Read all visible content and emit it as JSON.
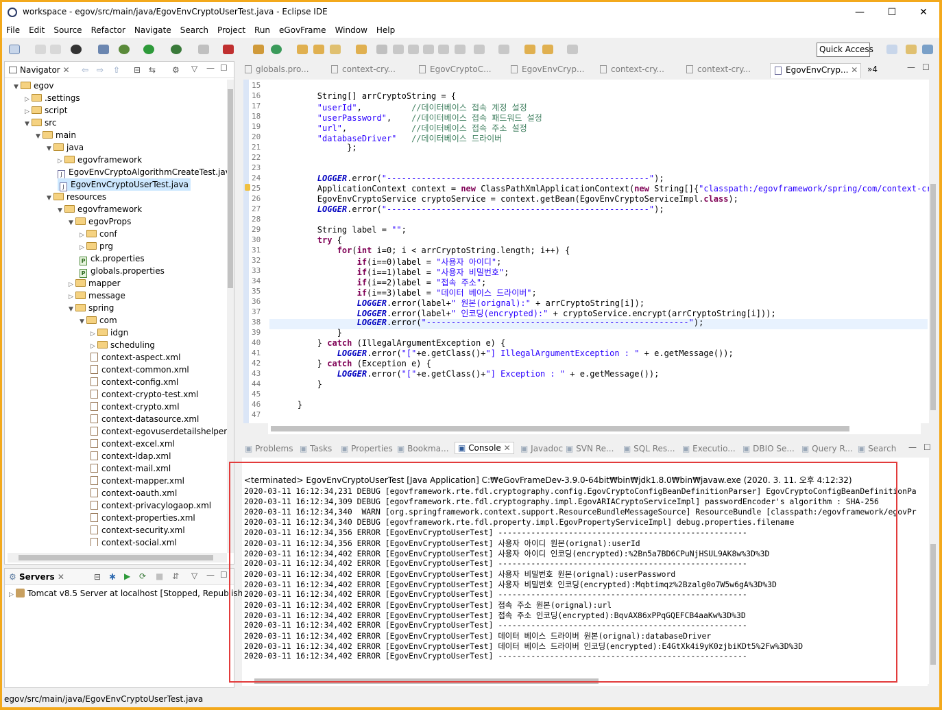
{
  "window": {
    "title": "workspace - egov/src/main/java/EgovEnvCryptoUserTest.java - Eclipse IDE",
    "minimize": "—",
    "maximize": "☐",
    "close": "✕"
  },
  "menu": [
    "File",
    "Edit",
    "Source",
    "Refactor",
    "Navigate",
    "Search",
    "Project",
    "Run",
    "eGovFrame",
    "Window",
    "Help"
  ],
  "toolbar": {
    "quick_access": "Quick Access"
  },
  "navigator": {
    "title": "Navigator",
    "items": [
      {
        "label": "egov",
        "kind": "project",
        "depth": 0,
        "open": true
      },
      {
        "label": ".settings",
        "kind": "folder",
        "depth": 1,
        "open": false
      },
      {
        "label": "script",
        "kind": "folder",
        "depth": 1,
        "open": false
      },
      {
        "label": "src",
        "kind": "folder",
        "depth": 1,
        "open": true
      },
      {
        "label": "main",
        "kind": "folder",
        "depth": 2,
        "open": true
      },
      {
        "label": "java",
        "kind": "folder",
        "depth": 3,
        "open": true
      },
      {
        "label": "egovframework",
        "kind": "folder",
        "depth": 4,
        "open": false
      },
      {
        "label": "EgovEnvCryptoAlgorithmCreateTest.java",
        "kind": "java",
        "depth": 4
      },
      {
        "label": "EgovEnvCryptoUserTest.java",
        "kind": "java",
        "depth": 4,
        "selected": true
      },
      {
        "label": "resources",
        "kind": "folder",
        "depth": 3,
        "open": true
      },
      {
        "label": "egovframework",
        "kind": "folder",
        "depth": 4,
        "open": true
      },
      {
        "label": "egovProps",
        "kind": "folder",
        "depth": 5,
        "open": true
      },
      {
        "label": "conf",
        "kind": "folder",
        "depth": 6,
        "open": false
      },
      {
        "label": "prg",
        "kind": "folder",
        "depth": 6,
        "open": false
      },
      {
        "label": "ck.properties",
        "kind": "props",
        "depth": 6
      },
      {
        "label": "globals.properties",
        "kind": "props",
        "depth": 6
      },
      {
        "label": "mapper",
        "kind": "folder",
        "depth": 5,
        "open": false
      },
      {
        "label": "message",
        "kind": "folder",
        "depth": 5,
        "open": false
      },
      {
        "label": "spring",
        "kind": "folder",
        "depth": 5,
        "open": true
      },
      {
        "label": "com",
        "kind": "folder",
        "depth": 6,
        "open": true
      },
      {
        "label": "idgn",
        "kind": "folder",
        "depth": 7,
        "open": false
      },
      {
        "label": "scheduling",
        "kind": "folder",
        "depth": 7,
        "open": false
      },
      {
        "label": "context-aspect.xml",
        "kind": "xml",
        "depth": 7
      },
      {
        "label": "context-common.xml",
        "kind": "xml",
        "depth": 7
      },
      {
        "label": "context-config.xml",
        "kind": "xml",
        "depth": 7
      },
      {
        "label": "context-crypto-test.xml",
        "kind": "xml",
        "depth": 7
      },
      {
        "label": "context-crypto.xml",
        "kind": "xml",
        "depth": 7
      },
      {
        "label": "context-datasource.xml",
        "kind": "xml",
        "depth": 7
      },
      {
        "label": "context-egovuserdetailshelper.x",
        "kind": "xml",
        "depth": 7
      },
      {
        "label": "context-excel.xml",
        "kind": "xml",
        "depth": 7
      },
      {
        "label": "context-ldap.xml",
        "kind": "xml",
        "depth": 7
      },
      {
        "label": "context-mail.xml",
        "kind": "xml",
        "depth": 7
      },
      {
        "label": "context-mapper.xml",
        "kind": "xml",
        "depth": 7
      },
      {
        "label": "context-oauth.xml",
        "kind": "xml",
        "depth": 7
      },
      {
        "label": "context-privacylogaop.xml",
        "kind": "xml",
        "depth": 7
      },
      {
        "label": "context-properties.xml",
        "kind": "xml",
        "depth": 7
      },
      {
        "label": "context-security.xml",
        "kind": "xml",
        "depth": 7
      },
      {
        "label": "context-social.xml",
        "kind": "xml",
        "depth": 7
      }
    ]
  },
  "servers": {
    "title": "Servers",
    "item": "Tomcat v8.5 Server at localhost  [Stopped, Republish]"
  },
  "editor": {
    "tabs": [
      "globals.pro...",
      "context-cry...",
      "EgovCryptoC...",
      "EgovEnvCryp...",
      "context-cry...",
      "context-cry...",
      "EgovEnvCryp..."
    ],
    "overflow": "»4",
    "lines": [
      {
        "n": "15",
        "t": ""
      },
      {
        "n": "16",
        "t": "        String[] arrCryptoString = {"
      },
      {
        "n": "17",
        "t": "        \"userId\",          //데이터베이스 접속 계정 설정"
      },
      {
        "n": "18",
        "t": "        \"userPassword\",    //데이터베이스 접속 패드워드 설정"
      },
      {
        "n": "19",
        "t": "        \"url\",             //데이터베이스 접속 주소 설정"
      },
      {
        "n": "20",
        "t": "        \"databaseDriver\"   //데이터베이스 드라이버"
      },
      {
        "n": "21",
        "t": "              };"
      },
      {
        "n": "22",
        "t": ""
      },
      {
        "n": "23",
        "t": ""
      },
      {
        "n": "24",
        "t": "        LOGGER.error(\"-----------------------------------------------------\");"
      },
      {
        "n": "25",
        "t": "        ApplicationContext context = new ClassPathXmlApplicationContext(new String[]{\"classpath:/egovframework/spring/com/context-crypto"
      },
      {
        "n": "26",
        "t": "        EgovEnvCryptoService cryptoService = context.getBean(EgovEnvCryptoServiceImpl.class);"
      },
      {
        "n": "27",
        "t": "        LOGGER.error(\"-----------------------------------------------------\");"
      },
      {
        "n": "28",
        "t": ""
      },
      {
        "n": "29",
        "t": "        String label = \"\";"
      },
      {
        "n": "30",
        "t": "        try {"
      },
      {
        "n": "31",
        "t": "            for(int i=0; i < arrCryptoString.length; i++) {"
      },
      {
        "n": "32",
        "t": "                if(i==0)label = \"사용자 아이디\";"
      },
      {
        "n": "33",
        "t": "                if(i==1)label = \"사용자 비밀번호\";"
      },
      {
        "n": "34",
        "t": "                if(i==2)label = \"접속 주소\";"
      },
      {
        "n": "35",
        "t": "                if(i==3)label = \"데이터 베이스 드라이버\";"
      },
      {
        "n": "36",
        "t": "                LOGGER.error(label+\" 원본(orignal):\" + arrCryptoString[i]);"
      },
      {
        "n": "37",
        "t": "                LOGGER.error(label+\" 인코딩(encrypted):\" + cryptoService.encrypt(arrCryptoString[i]));"
      },
      {
        "n": "38",
        "t": "                LOGGER.error(\"-----------------------------------------------------\");"
      },
      {
        "n": "39",
        "t": "            }"
      },
      {
        "n": "40",
        "t": "        } catch (IllegalArgumentException e) {"
      },
      {
        "n": "41",
        "t": "            LOGGER.error(\"[\"+e.getClass()+\"] IllegalArgumentException : \" + e.getMessage());"
      },
      {
        "n": "42",
        "t": "        } catch (Exception e) {"
      },
      {
        "n": "43",
        "t": "            LOGGER.error(\"[\"+e.getClass()+\"] Exception : \" + e.getMessage());"
      },
      {
        "n": "44",
        "t": "        }"
      },
      {
        "n": "45",
        "t": ""
      },
      {
        "n": "46",
        "t": "    }"
      },
      {
        "n": "47",
        "t": ""
      }
    ]
  },
  "bottom_tabs": [
    "Problems",
    "Tasks",
    "Properties",
    "Bookma...",
    "Console",
    "Javadoc",
    "SVN Re...",
    "SQL Res...",
    "Executio...",
    "DBIO Se...",
    "Query R...",
    "Search"
  ],
  "console": {
    "terminated": "<terminated> EgovEnvCryptoUserTest [Java Application] C:₩eGovFrameDev-3.9.0-64bit₩bin₩jdk1.8.0₩bin₩javaw.exe (2020. 3. 11. 오후 4:12:32)",
    "lines": [
      "2020-03-11 16:12:34,231 DEBUG [egovframework.rte.fdl.cryptography.config.EgovCryptoConfigBeanDefinitionParser] EgovCryptoConfigBeanDefinitionPa",
      "2020-03-11 16:12:34,309 DEBUG [egovframework.rte.fdl.cryptography.impl.EgovARIACryptoServiceImpl] passwordEncoder's algorithm : SHA-256",
      "2020-03-11 16:12:34,340  WARN [org.springframework.context.support.ResourceBundleMessageSource] ResourceBundle [classpath:/egovframework/egovPr",
      "2020-03-11 16:12:34,340 DEBUG [egovframework.rte.fdl.property.impl.EgovPropertyServiceImpl] debug.properties.filename",
      "2020-03-11 16:12:34,356 ERROR [EgovEnvCryptoUserTest] -----------------------------------------------------",
      "2020-03-11 16:12:34,356 ERROR [EgovEnvCryptoUserTest] 사용자 아이디 원본(orignal):userId",
      "2020-03-11 16:12:34,402 ERROR [EgovEnvCryptoUserTest] 사용자 아이디 인코딩(encrypted):%2Bn5a7BD6CPuNjHSUL9AK8w%3D%3D",
      "2020-03-11 16:12:34,402 ERROR [EgovEnvCryptoUserTest] -----------------------------------------------------",
      "2020-03-11 16:12:34,402 ERROR [EgovEnvCryptoUserTest] 사용자 비밀번호 원본(orignal):userPassword",
      "2020-03-11 16:12:34,402 ERROR [EgovEnvCryptoUserTest] 사용자 비밀번호 인코딩(encrypted):Mqbtimqz%2Bzalg0o7W5w6gA%3D%3D",
      "2020-03-11 16:12:34,402 ERROR [EgovEnvCryptoUserTest] -----------------------------------------------------",
      "2020-03-11 16:12:34,402 ERROR [EgovEnvCryptoUserTest] 접속 주소 원본(orignal):url",
      "2020-03-11 16:12:34,402 ERROR [EgovEnvCryptoUserTest] 접속 주소 인코딩(encrypted):BqvAX86xPPqGQEFCB4aaKw%3D%3D",
      "2020-03-11 16:12:34,402 ERROR [EgovEnvCryptoUserTest] -----------------------------------------------------",
      "2020-03-11 16:12:34,402 ERROR [EgovEnvCryptoUserTest] 데이터 베이스 드라이버 원본(orignal):databaseDriver",
      "2020-03-11 16:12:34,402 ERROR [EgovEnvCryptoUserTest] 데이터 베이스 드라이버 인코딩(encrypted):E4GtXk4i9yK0zjbiKDt5%2Fw%3D%3D",
      "2020-03-11 16:12:34,402 ERROR [EgovEnvCryptoUserTest] -----------------------------------------------------"
    ]
  },
  "status": {
    "path": "egov/src/main/java/EgovEnvCryptoUserTest.java"
  },
  "colors": {
    "highlight_box": "#e23b3b",
    "window_frame": "#f3a91c"
  }
}
